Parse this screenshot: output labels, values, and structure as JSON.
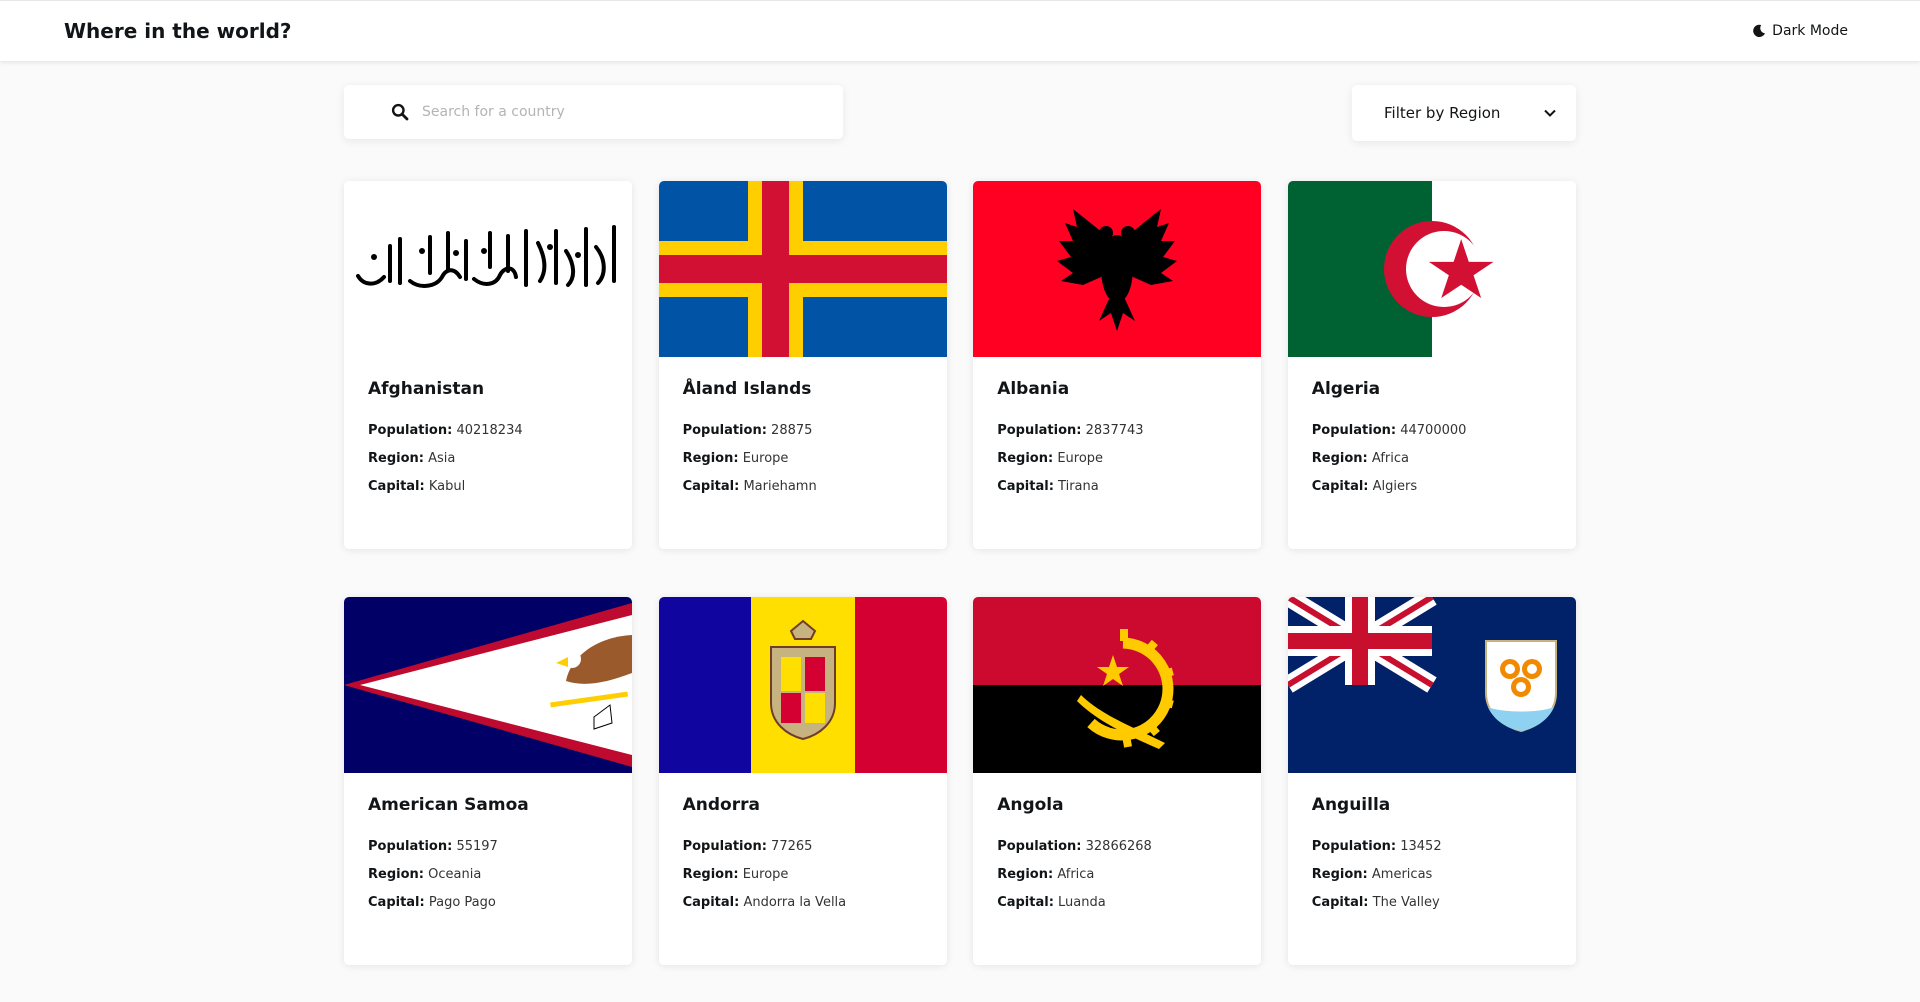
{
  "header": {
    "title": "Where in the world?",
    "mode_label": "Dark Mode"
  },
  "search": {
    "placeholder": "Search for a country",
    "value": ""
  },
  "filter": {
    "label": "Filter by Region"
  },
  "labels": {
    "population": "Population:",
    "region": "Region:",
    "capital": "Capital:"
  },
  "countries": [
    {
      "name": "Afghanistan",
      "population": "40218234",
      "region": "Asia",
      "capital": "Kabul",
      "flag_icon": "afghanistan-flag-icon"
    },
    {
      "name": "Åland Islands",
      "population": "28875",
      "region": "Europe",
      "capital": "Mariehamn",
      "flag_icon": "aland-flag-icon"
    },
    {
      "name": "Albania",
      "population": "2837743",
      "region": "Europe",
      "capital": "Tirana",
      "flag_icon": "albania-flag-icon"
    },
    {
      "name": "Algeria",
      "population": "44700000",
      "region": "Africa",
      "capital": "Algiers",
      "flag_icon": "algeria-flag-icon"
    },
    {
      "name": "American Samoa",
      "population": "55197",
      "region": "Oceania",
      "capital": "Pago Pago",
      "flag_icon": "american-samoa-flag-icon"
    },
    {
      "name": "Andorra",
      "population": "77265",
      "region": "Europe",
      "capital": "Andorra la Vella",
      "flag_icon": "andorra-flag-icon"
    },
    {
      "name": "Angola",
      "population": "32866268",
      "region": "Africa",
      "capital": "Luanda",
      "flag_icon": "angola-flag-icon"
    },
    {
      "name": "Anguilla",
      "population": "13452",
      "region": "Americas",
      "capital": "The Valley",
      "flag_icon": "anguilla-flag-icon"
    }
  ],
  "colors": {
    "background": "#fafafa",
    "surface": "#ffffff",
    "text": "#111517",
    "placeholder": "#b4b4b4"
  }
}
